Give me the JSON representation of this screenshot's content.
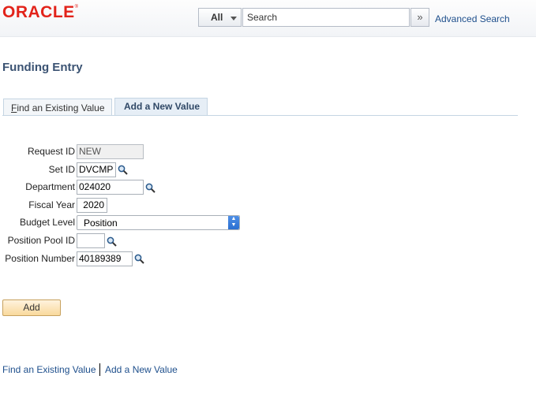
{
  "header": {
    "logo": "ORACLE",
    "search_scope": "All",
    "search_placeholder": "Search",
    "advanced_search": "Advanced Search"
  },
  "page": {
    "title": "Funding Entry"
  },
  "tabs": [
    {
      "label_first": "F",
      "label_rest": "ind an Existing Value",
      "active": false
    },
    {
      "label": "Add a New Value",
      "active": true
    }
  ],
  "form": {
    "request_id": {
      "label": "Request ID",
      "value": "NEW"
    },
    "set_id": {
      "label": "Set ID",
      "value": "DVCMP"
    },
    "department": {
      "label": "Department",
      "value": "024020"
    },
    "fiscal_year": {
      "label": "Fiscal Year",
      "value": "2020"
    },
    "budget_level": {
      "label": "Budget Level",
      "value": "Position"
    },
    "position_pool_id": {
      "label": "Position Pool ID",
      "value": ""
    },
    "position_number": {
      "label": "Position Number",
      "value": "40189389"
    }
  },
  "actions": {
    "add": "Add"
  },
  "footer": {
    "find_link": "Find an Existing Value",
    "add_link": "Add a New Value"
  },
  "colors": {
    "brand": "#e2231a",
    "link": "#1e4f8c",
    "title": "#3b5373"
  }
}
